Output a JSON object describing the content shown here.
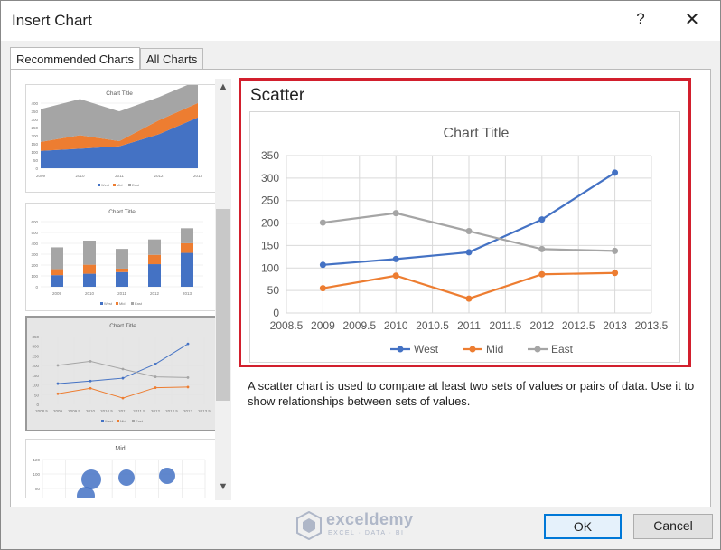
{
  "window": {
    "title": "Insert Chart",
    "help_label": "?",
    "close_label": "✕",
    "accent_color": "#217346"
  },
  "tabs": [
    {
      "label": "Recommended Charts",
      "active": true
    },
    {
      "label": "All Charts",
      "active": false
    }
  ],
  "thumbnails": [
    {
      "title": "Chart Title",
      "kind": "stacked-area",
      "yticks": [
        "400",
        "350",
        "300",
        "250",
        "200",
        "150",
        "100",
        "50",
        "0"
      ],
      "xticks": [
        "2009",
        "2010",
        "2011",
        "2012",
        "2013"
      ],
      "legend": [
        "West",
        "Mid",
        "East"
      ]
    },
    {
      "title": "Chart Title",
      "kind": "stacked-column",
      "yticks": [
        "600",
        "500",
        "400",
        "300",
        "200",
        "100",
        "0"
      ],
      "xticks": [
        "2009",
        "2010",
        "2011",
        "2012",
        "2013"
      ],
      "legend": [
        "West",
        "Mid",
        "East"
      ]
    },
    {
      "title": "Chart Title",
      "kind": "scatter",
      "yticks": [
        "350",
        "300",
        "250",
        "200",
        "150",
        "100",
        "50",
        "0"
      ],
      "xticks": [
        "2008.5",
        "2009",
        "2009.5",
        "2010",
        "2010.5",
        "2011",
        "2011.5",
        "2012",
        "2012.5",
        "2013",
        "2013.5"
      ],
      "legend": [
        "West",
        "Mid",
        "East"
      ],
      "selected": true
    },
    {
      "title": "Mid",
      "kind": "bubble",
      "yticks": [
        "120",
        "100",
        "80",
        "60"
      ]
    }
  ],
  "scroll": {
    "up_icon": "▲",
    "down_icon": "▼"
  },
  "preview": {
    "chart_type_label": "Scatter",
    "description": "A scatter chart is used to compare at least two sets of values or pairs of data. Use it to show relationships between sets of values."
  },
  "chart_data": {
    "type": "scatter",
    "title": "Chart Title",
    "xlabel": "",
    "ylabel": "",
    "xlim": [
      2008.5,
      2013.5
    ],
    "ylim": [
      0,
      350
    ],
    "xticks": [
      2008.5,
      2009,
      2009.5,
      2010,
      2010.5,
      2011,
      2011.5,
      2012,
      2012.5,
      2013,
      2013.5
    ],
    "yticks": [
      0,
      50,
      100,
      150,
      200,
      250,
      300,
      350
    ],
    "grid": true,
    "legend_position": "bottom",
    "x": [
      2009,
      2010,
      2011,
      2012,
      2013
    ],
    "series": [
      {
        "name": "West",
        "color": "#4472c4",
        "values": [
          107,
          120,
          135,
          208,
          312
        ]
      },
      {
        "name": "Mid",
        "color": "#ed7d31",
        "values": [
          55,
          83,
          32,
          86,
          89
        ]
      },
      {
        "name": "East",
        "color": "#a5a5a5",
        "values": [
          201,
          222,
          182,
          142,
          138
        ]
      }
    ]
  },
  "watermark": {
    "name": "exceldemy",
    "tagline": "EXCEL · DATA · BI"
  },
  "buttons": {
    "ok": "OK",
    "cancel": "Cancel"
  }
}
